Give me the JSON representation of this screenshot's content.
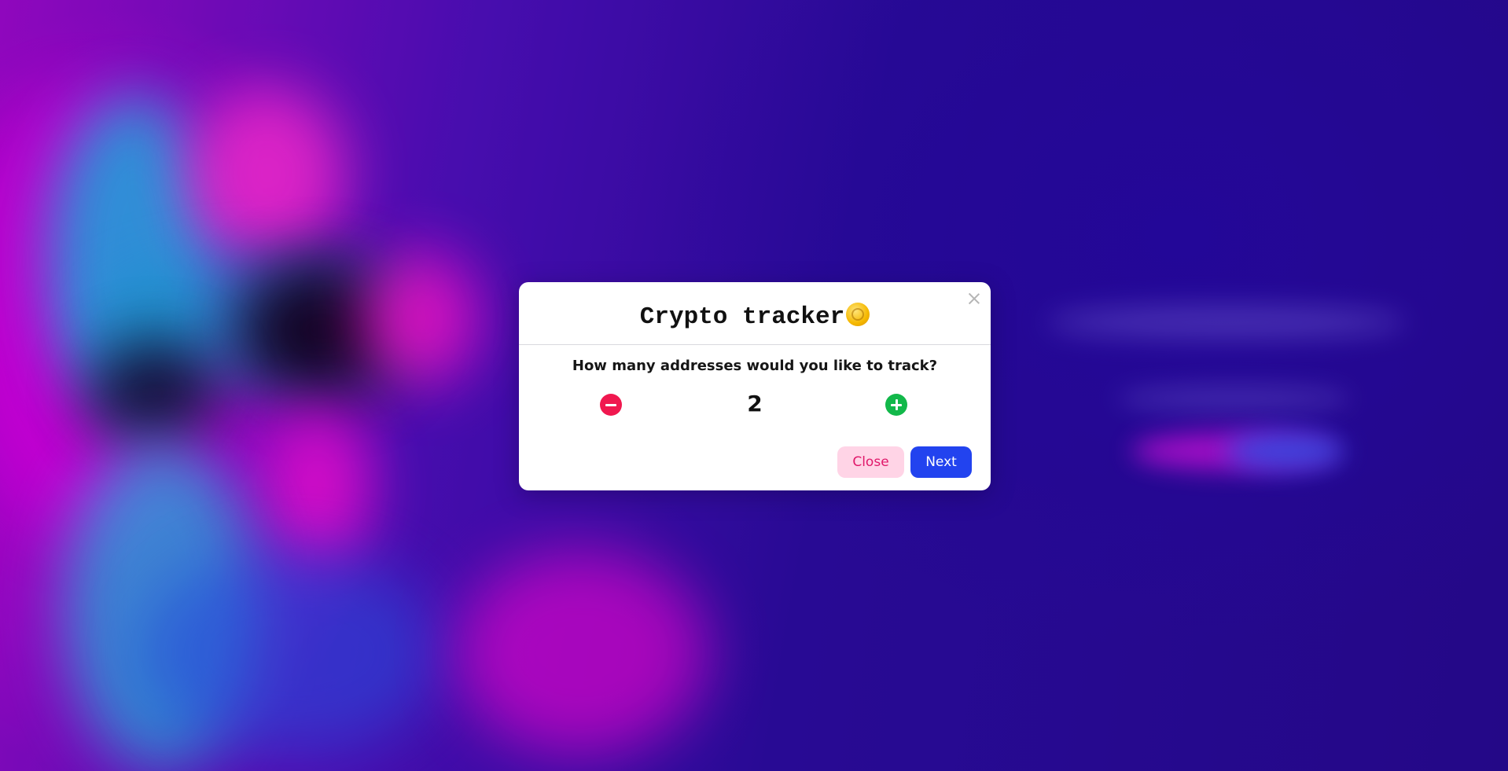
{
  "modal": {
    "title": "Crypto tracker",
    "question": "How many addresses would you like to track?",
    "count": "2",
    "close_label": "Close",
    "next_label": "Next"
  },
  "icons": {
    "title_icon": "coin-icon",
    "dismiss_icon": "close-icon",
    "decrement_icon": "minus-circle-icon",
    "increment_icon": "plus-circle-icon"
  },
  "colors": {
    "decrement": "#f0184f",
    "increment": "#12b84a",
    "next_button": "#2243ef",
    "close_button_bg": "#ffd4e6",
    "close_button_text": "#e0186a"
  }
}
